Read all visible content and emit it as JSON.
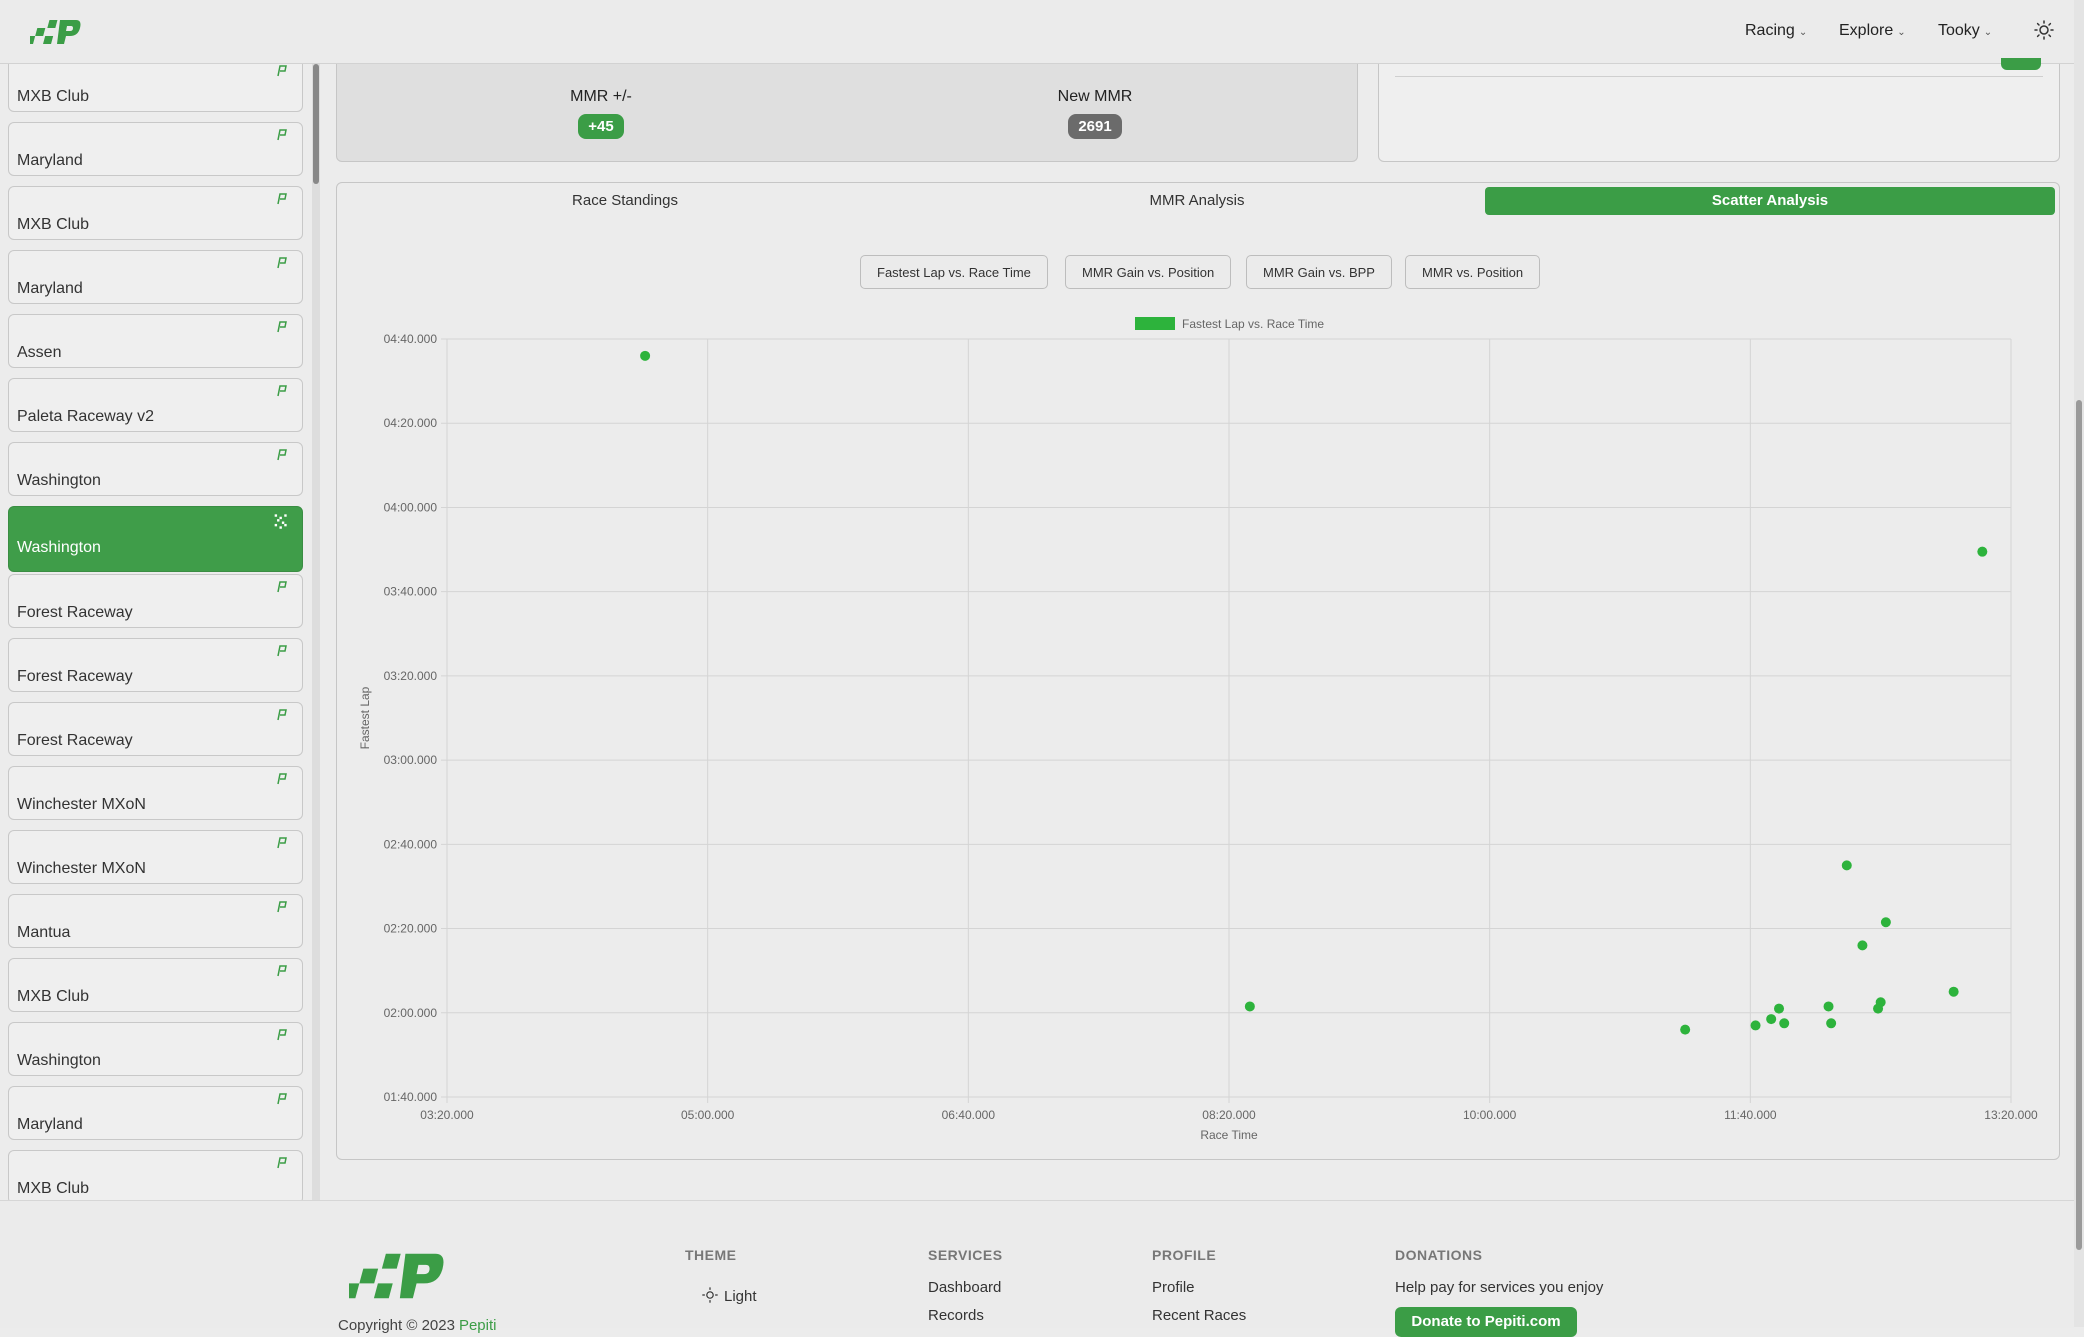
{
  "nav": {
    "items": [
      {
        "label": "Racing"
      },
      {
        "label": "Explore"
      },
      {
        "label": "Tooky"
      }
    ]
  },
  "sidebar": {
    "tracks": [
      {
        "name": "MXB Club"
      },
      {
        "name": "Maryland"
      },
      {
        "name": "MXB Club"
      },
      {
        "name": "Maryland"
      },
      {
        "name": "Assen"
      },
      {
        "name": "Paleta Raceway v2"
      },
      {
        "name": "Washington"
      },
      {
        "name": "Washington"
      },
      {
        "name": "Forest Raceway"
      },
      {
        "name": "Forest Raceway"
      },
      {
        "name": "Forest Raceway"
      },
      {
        "name": "Winchester MXoN"
      },
      {
        "name": "Winchester MXoN"
      },
      {
        "name": "Mantua"
      },
      {
        "name": "MXB Club"
      },
      {
        "name": "Washington"
      },
      {
        "name": "Maryland"
      },
      {
        "name": "MXB Club"
      }
    ]
  },
  "summary": {
    "mmr_change_label": "MMR +/-",
    "mmr_change_value": "+45",
    "new_mmr_label": "New MMR",
    "new_mmr_value": "2691"
  },
  "tabs": [
    {
      "label": "Race Standings"
    },
    {
      "label": "MMR Analysis"
    },
    {
      "label": "Scatter Analysis"
    }
  ],
  "chart_buttons": [
    {
      "label": "Fastest Lap vs. Race Time"
    },
    {
      "label": "MMR Gain vs. Position"
    },
    {
      "label": "MMR Gain vs. BPP"
    },
    {
      "label": "MMR vs. Position"
    }
  ],
  "chart_data": {
    "type": "scatter",
    "title": "",
    "legend": "Fastest Lap vs. Race Time",
    "legend_placement": "top-center",
    "xlabel": "Race Time",
    "ylabel": "Fastest Lap",
    "color": "#2db33c",
    "grid": true,
    "xlim": [
      200,
      800
    ],
    "ylim": [
      100,
      280
    ],
    "x_ticks": [
      {
        "value": 200,
        "label": "03:20.000"
      },
      {
        "value": 300,
        "label": "05:00.000"
      },
      {
        "value": 400,
        "label": "06:40.000"
      },
      {
        "value": 500,
        "label": "08:20.000"
      },
      {
        "value": 600,
        "label": "10:00.000"
      },
      {
        "value": 700,
        "label": "11:40.000"
      },
      {
        "value": 800,
        "label": "13:20.000"
      }
    ],
    "y_ticks": [
      {
        "value": 100,
        "label": "01:40.000"
      },
      {
        "value": 120,
        "label": "02:00.000"
      },
      {
        "value": 140,
        "label": "02:20.000"
      },
      {
        "value": 160,
        "label": "02:40.000"
      },
      {
        "value": 180,
        "label": "03:00.000"
      },
      {
        "value": 200,
        "label": "03:20.000"
      },
      {
        "value": 220,
        "label": "03:40.000"
      },
      {
        "value": 240,
        "label": "04:00.000"
      },
      {
        "value": 260,
        "label": "04:20.000"
      },
      {
        "value": 280,
        "label": "04:40.000"
      }
    ],
    "points": [
      {
        "x": 276,
        "y": 276
      },
      {
        "x": 508,
        "y": 121.5
      },
      {
        "x": 675,
        "y": 116
      },
      {
        "x": 702,
        "y": 117
      },
      {
        "x": 708,
        "y": 118.5
      },
      {
        "x": 711,
        "y": 121
      },
      {
        "x": 713,
        "y": 117.5
      },
      {
        "x": 730,
        "y": 121.5
      },
      {
        "x": 731,
        "y": 117.5
      },
      {
        "x": 737,
        "y": 155
      },
      {
        "x": 743,
        "y": 136
      },
      {
        "x": 749,
        "y": 121
      },
      {
        "x": 750,
        "y": 122.5
      },
      {
        "x": 752,
        "y": 141.5
      },
      {
        "x": 778,
        "y": 125
      },
      {
        "x": 789,
        "y": 229.5
      }
    ]
  },
  "footer": {
    "theme_heading": "THEME",
    "theme_value": "Light",
    "services_heading": "SERVICES",
    "services_links": [
      "Dashboard",
      "Records"
    ],
    "profile_heading": "PROFILE",
    "profile_links": [
      "Profile",
      "Recent Races"
    ],
    "donations_heading": "DONATIONS",
    "donations_text": "Help pay for services you enjoy",
    "donate_button": "Donate to Pepiti.com",
    "copyright": "Copyright © 2023",
    "copyright_link": "Pepiti"
  }
}
